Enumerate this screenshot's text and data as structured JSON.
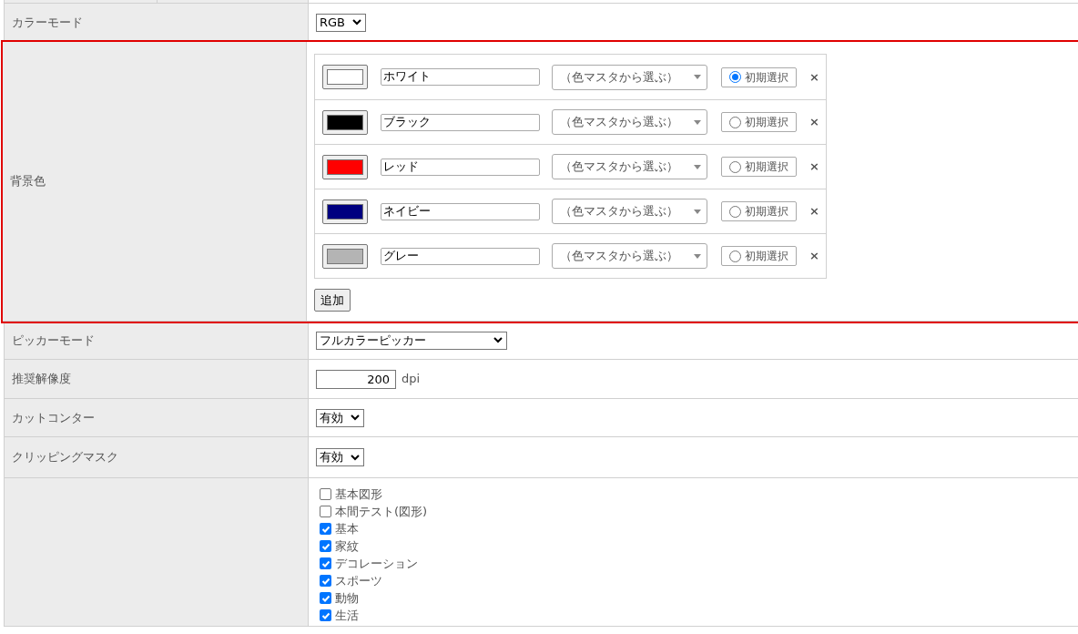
{
  "rows": [
    {
      "kind": "select",
      "label": "カラーモード",
      "value": "RGB",
      "highlighted": false
    },
    {
      "kind": "colors",
      "label": "背景色",
      "highlighted": true,
      "add_button": "追加",
      "colors": [
        {
          "name": "ホワイト",
          "color": "#ffffff",
          "master": "（色マスタから選ぶ）",
          "default_label": "初期選択",
          "selected": true,
          "remove": "×"
        },
        {
          "name": "ブラック",
          "color": "#000000",
          "master": "（色マスタから選ぶ）",
          "default_label": "初期選択",
          "selected": false,
          "remove": "×"
        },
        {
          "name": "レッド",
          "color": "#ff0000",
          "master": "（色マスタから選ぶ）",
          "default_label": "初期選択",
          "selected": false,
          "remove": "×"
        },
        {
          "name": "ネイビー",
          "color": "#000080",
          "master": "（色マスタから選ぶ）",
          "default_label": "初期選択",
          "selected": false,
          "remove": "×"
        },
        {
          "name": "グレー",
          "color": "#b4b4b4",
          "master": "（色マスタから選ぶ）",
          "default_label": "初期選択",
          "selected": false,
          "remove": "×"
        }
      ]
    },
    {
      "kind": "wide-select",
      "label": "ピッカーモード",
      "value": "フルカラーピッカー",
      "highlighted": false
    },
    {
      "kind": "number",
      "label": "推奨解像度",
      "value": "200",
      "unit": "dpi",
      "highlighted": false
    },
    {
      "kind": "select",
      "label": "カットコンター",
      "value": "有効",
      "highlighted": false
    },
    {
      "kind": "select",
      "label": "クリッピングマスク",
      "value": "有効",
      "highlighted": false
    },
    {
      "kind": "checkboxes",
      "highlighted": false,
      "items": [
        {
          "label": "基本図形",
          "checked": false
        },
        {
          "label": "本間テスト(図形)",
          "checked": false
        },
        {
          "label": "基本",
          "checked": true
        },
        {
          "label": "家紋",
          "checked": true
        },
        {
          "label": "デコレーション",
          "checked": true
        },
        {
          "label": "スポーツ",
          "checked": true
        },
        {
          "label": "動物",
          "checked": true
        },
        {
          "label": "生活",
          "checked": true
        }
      ]
    }
  ]
}
